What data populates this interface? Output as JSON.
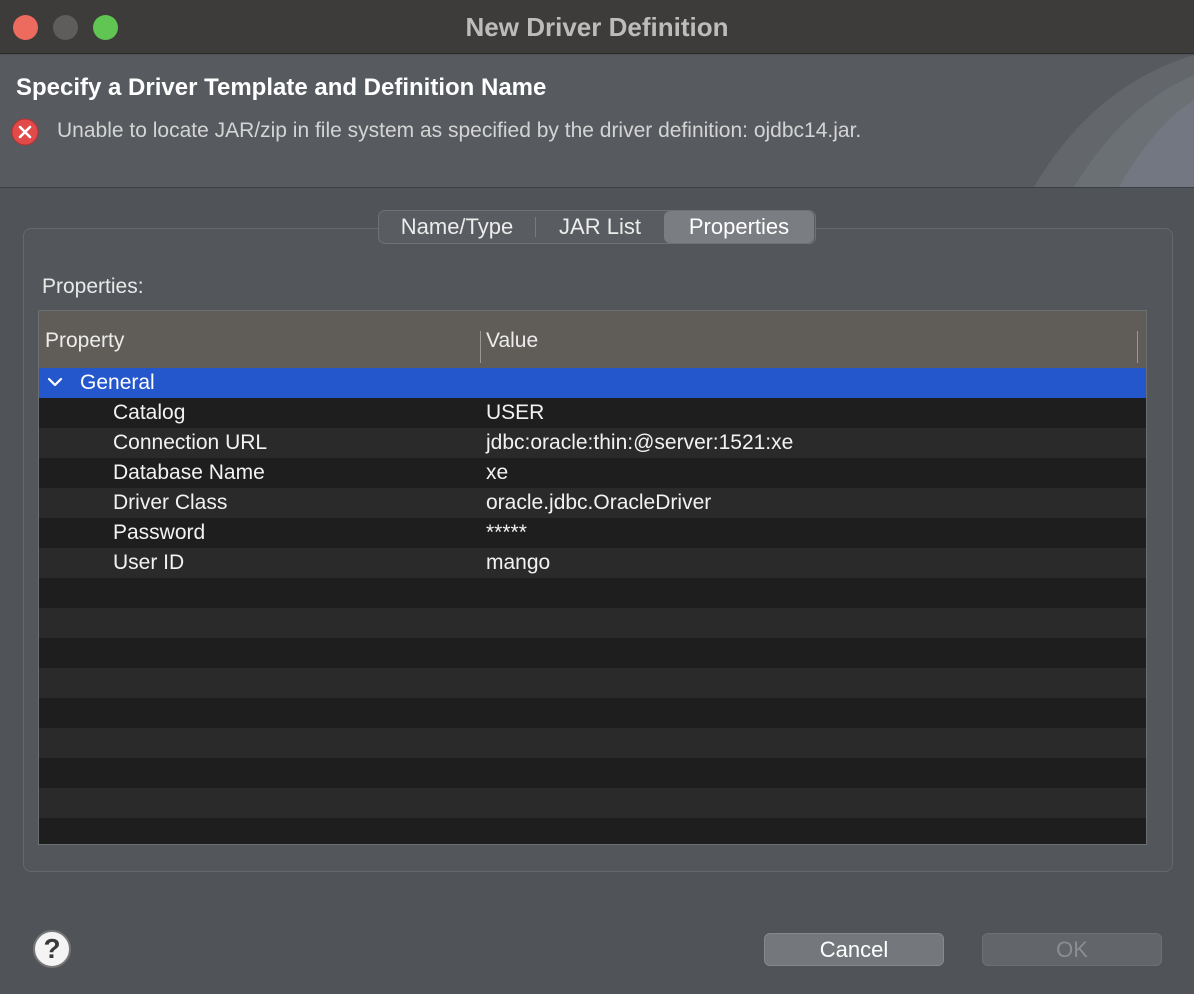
{
  "window": {
    "title": "New Driver Definition"
  },
  "header": {
    "title": "Specify a Driver Template and Definition Name",
    "error_message": "Unable to locate JAR/zip in file system as specified by the driver definition: ojdbc14.jar.",
    "error_icon": "error-icon"
  },
  "tabs": [
    {
      "label": "Name/Type",
      "selected": false
    },
    {
      "label": "JAR List",
      "selected": false
    },
    {
      "label": "Properties",
      "selected": true
    }
  ],
  "properties_label": "Properties:",
  "table": {
    "columns": [
      "Property",
      "Value"
    ],
    "group": {
      "label": "General",
      "expanded": true
    },
    "rows": [
      {
        "property": "Catalog",
        "value": "USER"
      },
      {
        "property": "Connection URL",
        "value": "jdbc:oracle:thin:@server:1521:xe"
      },
      {
        "property": "Database Name",
        "value": "xe"
      },
      {
        "property": "Driver Class",
        "value": "oracle.jdbc.OracleDriver"
      },
      {
        "property": "Password",
        "value": "*****"
      },
      {
        "property": "User ID",
        "value": "mango"
      }
    ]
  },
  "buttons": {
    "help_icon": "help-icon",
    "cancel": "Cancel",
    "ok": "OK"
  },
  "colors": {
    "selection": "#2456cc",
    "close": "#ed6a5e",
    "maximize": "#61c554"
  }
}
